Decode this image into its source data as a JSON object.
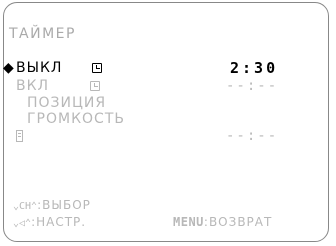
{
  "menu": {
    "title": "ТАЙМЕР",
    "selector": "◆",
    "items": [
      {
        "label": "ВЫКЛ",
        "value": "2:30"
      },
      {
        "label": "ВКЛ",
        "value": "--:--"
      },
      {
        "label": "ПОЗИЦИЯ"
      },
      {
        "label": "ГРОМКОСТЬ"
      },
      {
        "label": "",
        "value": "--:--"
      }
    ]
  },
  "footer": {
    "select_key": "⌄CH⌃",
    "select_label": ":ВЫБОР",
    "adjust_key": "⌄◁⌃",
    "adjust_label": ":НАСТР.",
    "menu_key": "MENU",
    "menu_label": ":ВОЗВРАТ"
  }
}
